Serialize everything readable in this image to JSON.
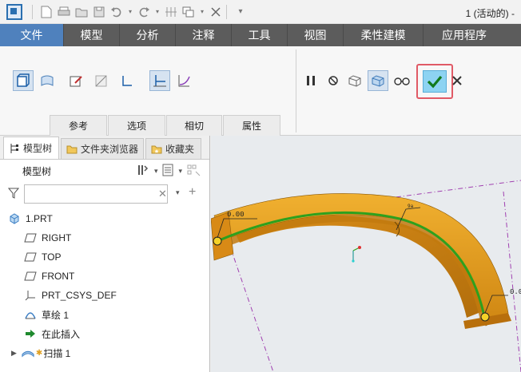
{
  "titlebar": {
    "title": "1 (活动的) -"
  },
  "tabs": [
    {
      "label": "文件"
    },
    {
      "label": "模型"
    },
    {
      "label": "分析"
    },
    {
      "label": "注释"
    },
    {
      "label": "工具"
    },
    {
      "label": "视图"
    },
    {
      "label": "柔性建模"
    },
    {
      "label": "应用程序"
    }
  ],
  "ribbon": {
    "groups": [
      "参考",
      "选项",
      "相切",
      "属性"
    ]
  },
  "panel_tabs": [
    {
      "label": "模型树"
    },
    {
      "label": "文件夹浏览器"
    },
    {
      "label": "收藏夹"
    }
  ],
  "tree_header": "模型树",
  "filter": {
    "value": "",
    "placeholder": ""
  },
  "tree_items": [
    {
      "label": "1.PRT"
    },
    {
      "label": "RIGHT"
    },
    {
      "label": "TOP"
    },
    {
      "label": "FRONT"
    },
    {
      "label": "PRT_CSYS_DEF"
    },
    {
      "label": "草绘 1"
    },
    {
      "label": "在此插入"
    },
    {
      "label": "扫描 1"
    }
  ],
  "graphics": {
    "dim_left": "0.00",
    "dim_right": "0.0",
    "dim_top": "9a",
    "colors": {
      "sweep": "#e0a020",
      "trajectory": "#2ea01e",
      "datum": "#a040b0"
    }
  }
}
